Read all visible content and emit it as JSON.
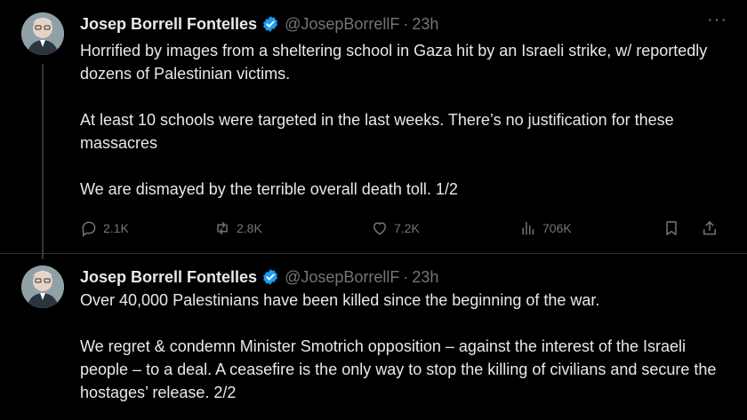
{
  "tweets": [
    {
      "author_name": "Josep Borrell Fontelles",
      "handle": "@JosepBorrellF",
      "separator": "·",
      "time": "23h",
      "paragraphs": [
        "Horrified by images from a sheltering school in Gaza hit by an Israeli strike, w/ reportedly dozens of Palestinian victims.",
        "At least 10 schools were targeted in the last weeks. There’s no justification for these massacres",
        "We are dismayed by the terrible overall death toll. 1/2"
      ],
      "stats": {
        "replies": "2.1K",
        "reposts": "2.8K",
        "likes": "7.2K",
        "views": "706K"
      }
    },
    {
      "author_name": "Josep Borrell Fontelles",
      "handle": "@JosepBorrellF",
      "separator": "·",
      "time": "23h",
      "paragraphs": [
        "Over 40,000 Palestinians have been killed since the beginning of the war.",
        "We regret & condemn Minister Smotrich opposition – against the interest of the Israeli people – to a deal. A ceasefire is the only way to stop the killing of civilians and secure the hostages’ release. 2/2"
      ]
    }
  ],
  "icons": {
    "more": "more-icon",
    "verified": "verified-badge-icon",
    "reply": "reply-icon",
    "repost": "repost-icon",
    "like": "like-icon",
    "views": "views-icon",
    "bookmark": "bookmark-icon",
    "share": "share-icon"
  },
  "colors": {
    "background": "#000000",
    "text": "#e7e9ea",
    "muted": "#71767b",
    "verified": "#1d9bf0"
  }
}
